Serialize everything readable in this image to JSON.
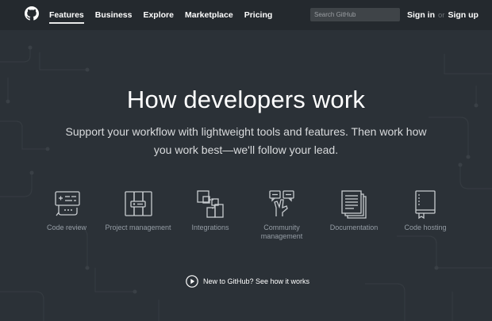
{
  "header": {
    "nav": [
      "Features",
      "Business",
      "Explore",
      "Marketplace",
      "Pricing"
    ],
    "search_placeholder": "Search GitHub",
    "sign_in": "Sign in",
    "or": "or",
    "sign_up": "Sign up"
  },
  "hero": {
    "title": "How developers work",
    "subtitle": "Support your workflow with lightweight tools and features. Then work how you work best—we'll follow your lead."
  },
  "features": [
    {
      "label": "Code review",
      "icon": "code-review-icon"
    },
    {
      "label": "Project management",
      "icon": "project-management-icon"
    },
    {
      "label": "Integrations",
      "icon": "integrations-icon"
    },
    {
      "label": "Community management",
      "icon": "community-management-icon"
    },
    {
      "label": "Documentation",
      "icon": "documentation-icon"
    },
    {
      "label": "Code hosting",
      "icon": "code-hosting-icon"
    }
  ],
  "video_link": "New to GitHub? See how it works",
  "colors": {
    "header_bg": "#24292e",
    "body_bg": "#2b3137",
    "label_gray": "#959da5"
  }
}
